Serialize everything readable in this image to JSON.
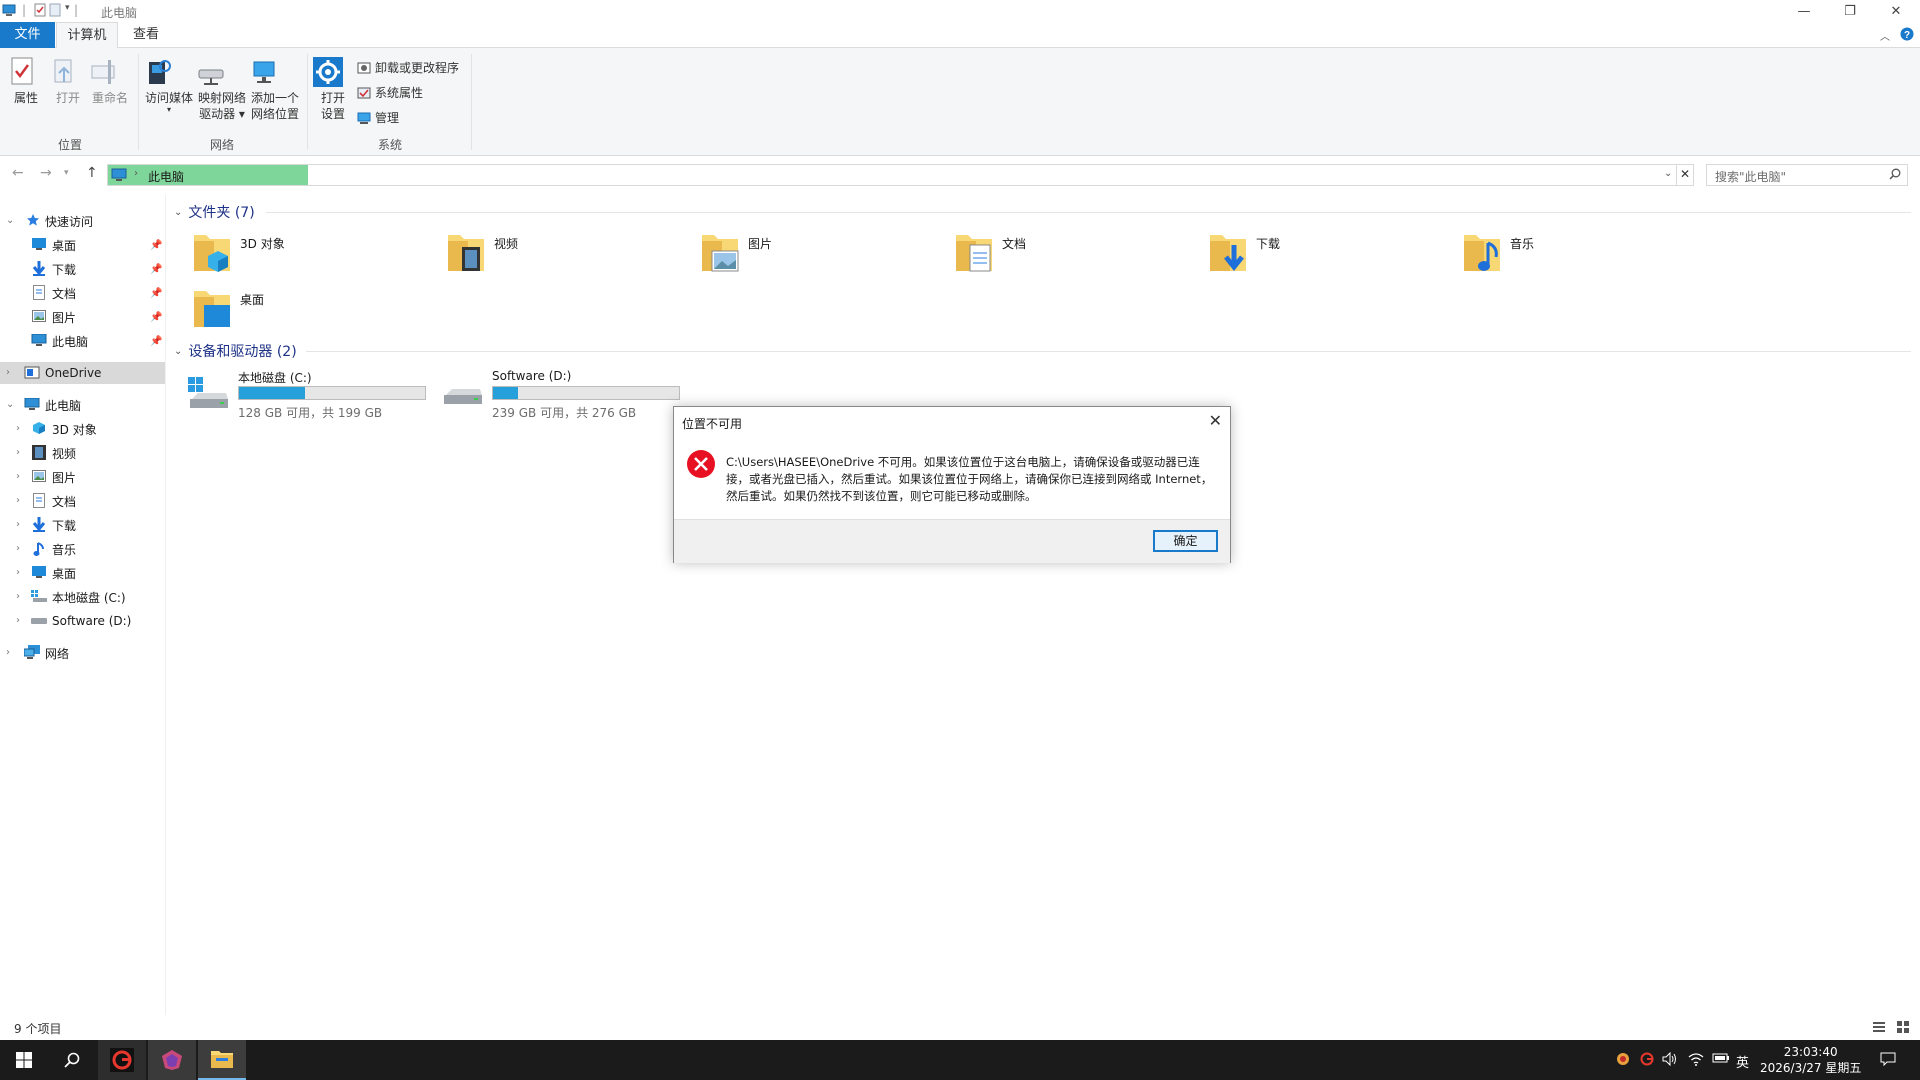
{
  "window": {
    "title": "此电脑",
    "minimize_label": "—",
    "restore_label": "❐",
    "close_label": "✕"
  },
  "ribbon_tabs": [
    {
      "label": "文件"
    },
    {
      "label": "计算机"
    },
    {
      "label": "查看"
    }
  ],
  "ribbon": {
    "properties": "属性",
    "open": "打开",
    "rename": "重命名",
    "group_location": "位置",
    "access_media": "访问媒体",
    "map_drive_1": "映射网络",
    "map_drive_2": "驱动器",
    "add_location_1": "添加一个",
    "add_location_2": "网络位置",
    "group_network": "网络",
    "open_settings_1": "打开",
    "open_settings_2": "设置",
    "uninstall": "卸载或更改程序",
    "system_props": "系统属性",
    "manage": "管理",
    "group_system": "系统"
  },
  "address": {
    "crumb": "此电脑",
    "search_placeholder": "搜索\"此电脑\""
  },
  "nav": {
    "quick_access": "快速访问",
    "qa_items": [
      {
        "label": "桌面"
      },
      {
        "label": "下载"
      },
      {
        "label": "文档"
      },
      {
        "label": "图片"
      },
      {
        "label": "此电脑"
      }
    ],
    "onedrive": "OneDrive",
    "this_pc": "此电脑",
    "pc_items": [
      {
        "label": "3D 对象"
      },
      {
        "label": "视频"
      },
      {
        "label": "图片"
      },
      {
        "label": "文档"
      },
      {
        "label": "下载"
      },
      {
        "label": "音乐"
      },
      {
        "label": "桌面"
      },
      {
        "label": "本地磁盘 (C:)"
      },
      {
        "label": "Software (D:)"
      }
    ],
    "network": "网络"
  },
  "content": {
    "folders_header": "文件夹 (7)",
    "folders": [
      {
        "label": "3D 对象",
        "icon": "3d-objects-folder-icon"
      },
      {
        "label": "视频",
        "icon": "videos-folder-icon"
      },
      {
        "label": "图片",
        "icon": "pictures-folder-icon"
      },
      {
        "label": "文档",
        "icon": "documents-folder-icon"
      },
      {
        "label": "下载",
        "icon": "downloads-folder-icon"
      },
      {
        "label": "音乐",
        "icon": "music-folder-icon"
      },
      {
        "label": "桌面",
        "icon": "desktop-folder-icon"
      }
    ],
    "drives_header": "设备和驱动器 (2)",
    "drives": [
      {
        "label": "本地磁盘 (C:)",
        "free": "128 GB 可用，共 199 GB",
        "used_fraction": 0.357
      },
      {
        "label": "Software (D:)",
        "free": "239 GB 可用，共 276 GB",
        "used_fraction": 0.134
      }
    ]
  },
  "status": {
    "items": "9 个项目"
  },
  "dialog": {
    "title": "位置不可用",
    "message": "C:\\Users\\HASEE\\OneDrive 不可用。如果该位置位于这台电脑上，请确保设备或驱动器已连接，或者光盘已插入，然后重试。如果该位置位于网络上，请确保你已连接到网络或 Internet，然后重试。如果仍然找不到该位置，则它可能已移动或删除。",
    "ok": "确定"
  },
  "taskbar": {
    "ime": "英",
    "time": "23:03:40",
    "date": "2026/3/27 星期五"
  },
  "colors": {
    "accent": "#1979ca",
    "address_highlight": "#7ed69a",
    "drive_bar": "#26a0da",
    "error_red": "#e81123"
  }
}
